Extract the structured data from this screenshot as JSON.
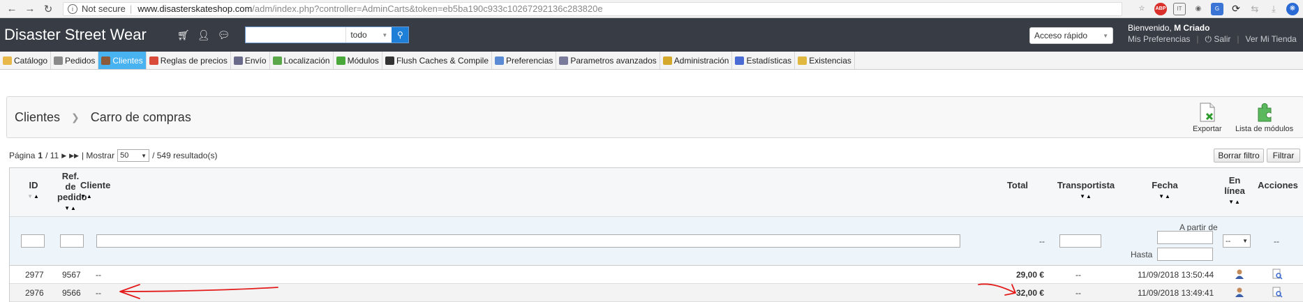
{
  "browser": {
    "secure_label": "Not secure",
    "url_host": "www.disasterskateshop.com",
    "url_path": "/adm/index.php?controller=AdminCarts&token=eb5ba190c933c10267292136c283820e",
    "extensions": [
      "star-icon",
      "adblock-icon",
      "extension-it-icon",
      "eye-icon",
      "extension-blue-icon",
      "sync-icon",
      "refresh-icon",
      "download-icon",
      "chrome-extension-icon"
    ]
  },
  "header": {
    "brand": "Disaster Street Wear",
    "search_scope": "todo",
    "quick_access": "Acceso rápido",
    "welcome": "Bienvenido,",
    "user_name": "M Criado",
    "preferences": "Mis Preferencias",
    "logout": "Salir",
    "view_store": "Ver Mi Tienda"
  },
  "tabs": [
    {
      "label": "Catálogo",
      "icon": "folder-icon",
      "color": "#e8b84a"
    },
    {
      "label": "Pedidos",
      "icon": "cart-icon",
      "color": "#8a8a8a"
    },
    {
      "label": "Clientes",
      "icon": "customer-icon",
      "color": "#8a5a3a",
      "active": true
    },
    {
      "label": "Reglas de precios",
      "icon": "price-rules-icon",
      "color": "#d94a3a"
    },
    {
      "label": "Envío",
      "icon": "truck-icon",
      "color": "#6a6a8a"
    },
    {
      "label": "Localización",
      "icon": "globe-icon",
      "color": "#5aa84a"
    },
    {
      "label": "Módulos",
      "icon": "puzzle-icon",
      "color": "#4aa83a"
    },
    {
      "label": "Flush Caches & Compile",
      "icon": "refresh-icon",
      "color": "#333333"
    },
    {
      "label": "Preferencias",
      "icon": "preferences-icon",
      "color": "#5a8ad4"
    },
    {
      "label": "Parametros avanzados",
      "icon": "wrench-icon",
      "color": "#7a7a9a"
    },
    {
      "label": "Administración",
      "icon": "key-icon",
      "color": "#d4a82a"
    },
    {
      "label": "Estadísticas",
      "icon": "stats-icon",
      "color": "#4a6ad4"
    },
    {
      "label": "Existencias",
      "icon": "stock-icon",
      "color": "#e0b840"
    }
  ],
  "toolbar": {
    "breadcrumb_parent": "Clientes",
    "breadcrumb_current": "Carro de compras",
    "export_label": "Exportar",
    "modules_label": "Lista de módulos"
  },
  "pager": {
    "page_label": "Página",
    "current": "1",
    "total": "/ 11",
    "show_label": "| Mostrar",
    "per_page": "50",
    "results": "/ 549 resultado(s)",
    "reset_filter": "Borrar filtro",
    "filter": "Filtrar"
  },
  "table": {
    "headers": {
      "id": "ID",
      "order_ref": "Ref. de pedido",
      "customer": "Cliente",
      "total": "Total",
      "carrier": "Transportista",
      "date": "Fecha",
      "online": "En línea",
      "actions": "Acciones"
    },
    "filters": {
      "total_placeholder": "--",
      "date_from": "A partir de",
      "date_to": "Hasta",
      "online_value": "--",
      "actions_placeholder": "--"
    },
    "rows": [
      {
        "id": "2977",
        "order_ref": "9567",
        "customer": "--",
        "total": "29,00 €",
        "carrier": "--",
        "date": "11/09/2018 13:50:44"
      },
      {
        "id": "2976",
        "order_ref": "9566",
        "customer": "--",
        "total": "32,00 €",
        "carrier": "--",
        "date": "11/09/2018 13:49:41"
      }
    ]
  },
  "colors": {
    "header_bg": "#383d45",
    "active_tab": "#49b2f0",
    "search_button": "#1e7fd8",
    "annotation": "#e31b1b"
  }
}
